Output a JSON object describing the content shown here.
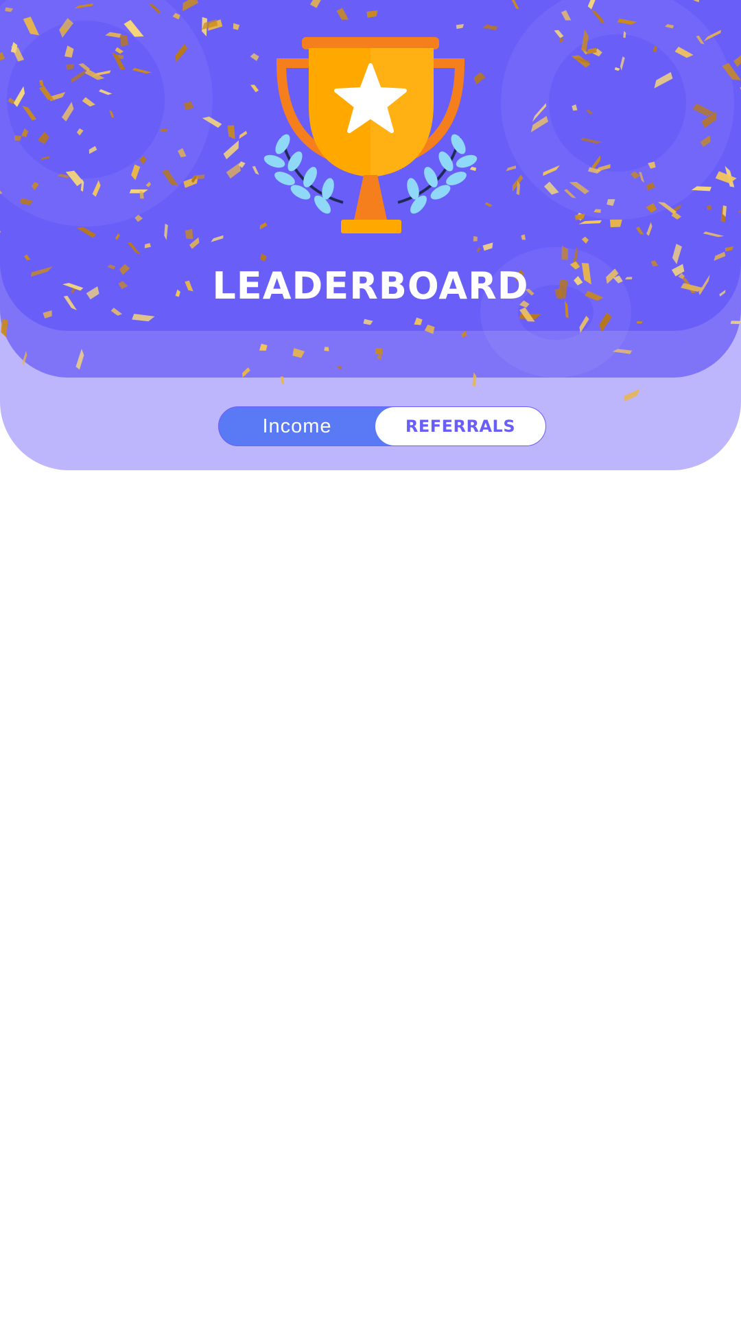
{
  "header": {
    "title": "LEADERBOARD"
  },
  "tabs": {
    "options": [
      {
        "label": "Income",
        "selected": false
      },
      {
        "label": "REFERRALS",
        "selected": true
      }
    ]
  },
  "colors": {
    "header_primary": "#6a5ef9",
    "header_secondary": "#7f74f8",
    "header_tertiary": "#bdb6fc",
    "tab_inactive_bg": "#5a7af5",
    "tab_active_text": "#6a5ef9",
    "trophy_gold": "#ffa800",
    "trophy_orange": "#f57f1c",
    "laurel_blue": "#8fd8f8"
  },
  "icons": {
    "trophy": "trophy-icon",
    "star": "star-icon",
    "laurel": "laurel-icon",
    "confetti": "confetti-decoration"
  }
}
